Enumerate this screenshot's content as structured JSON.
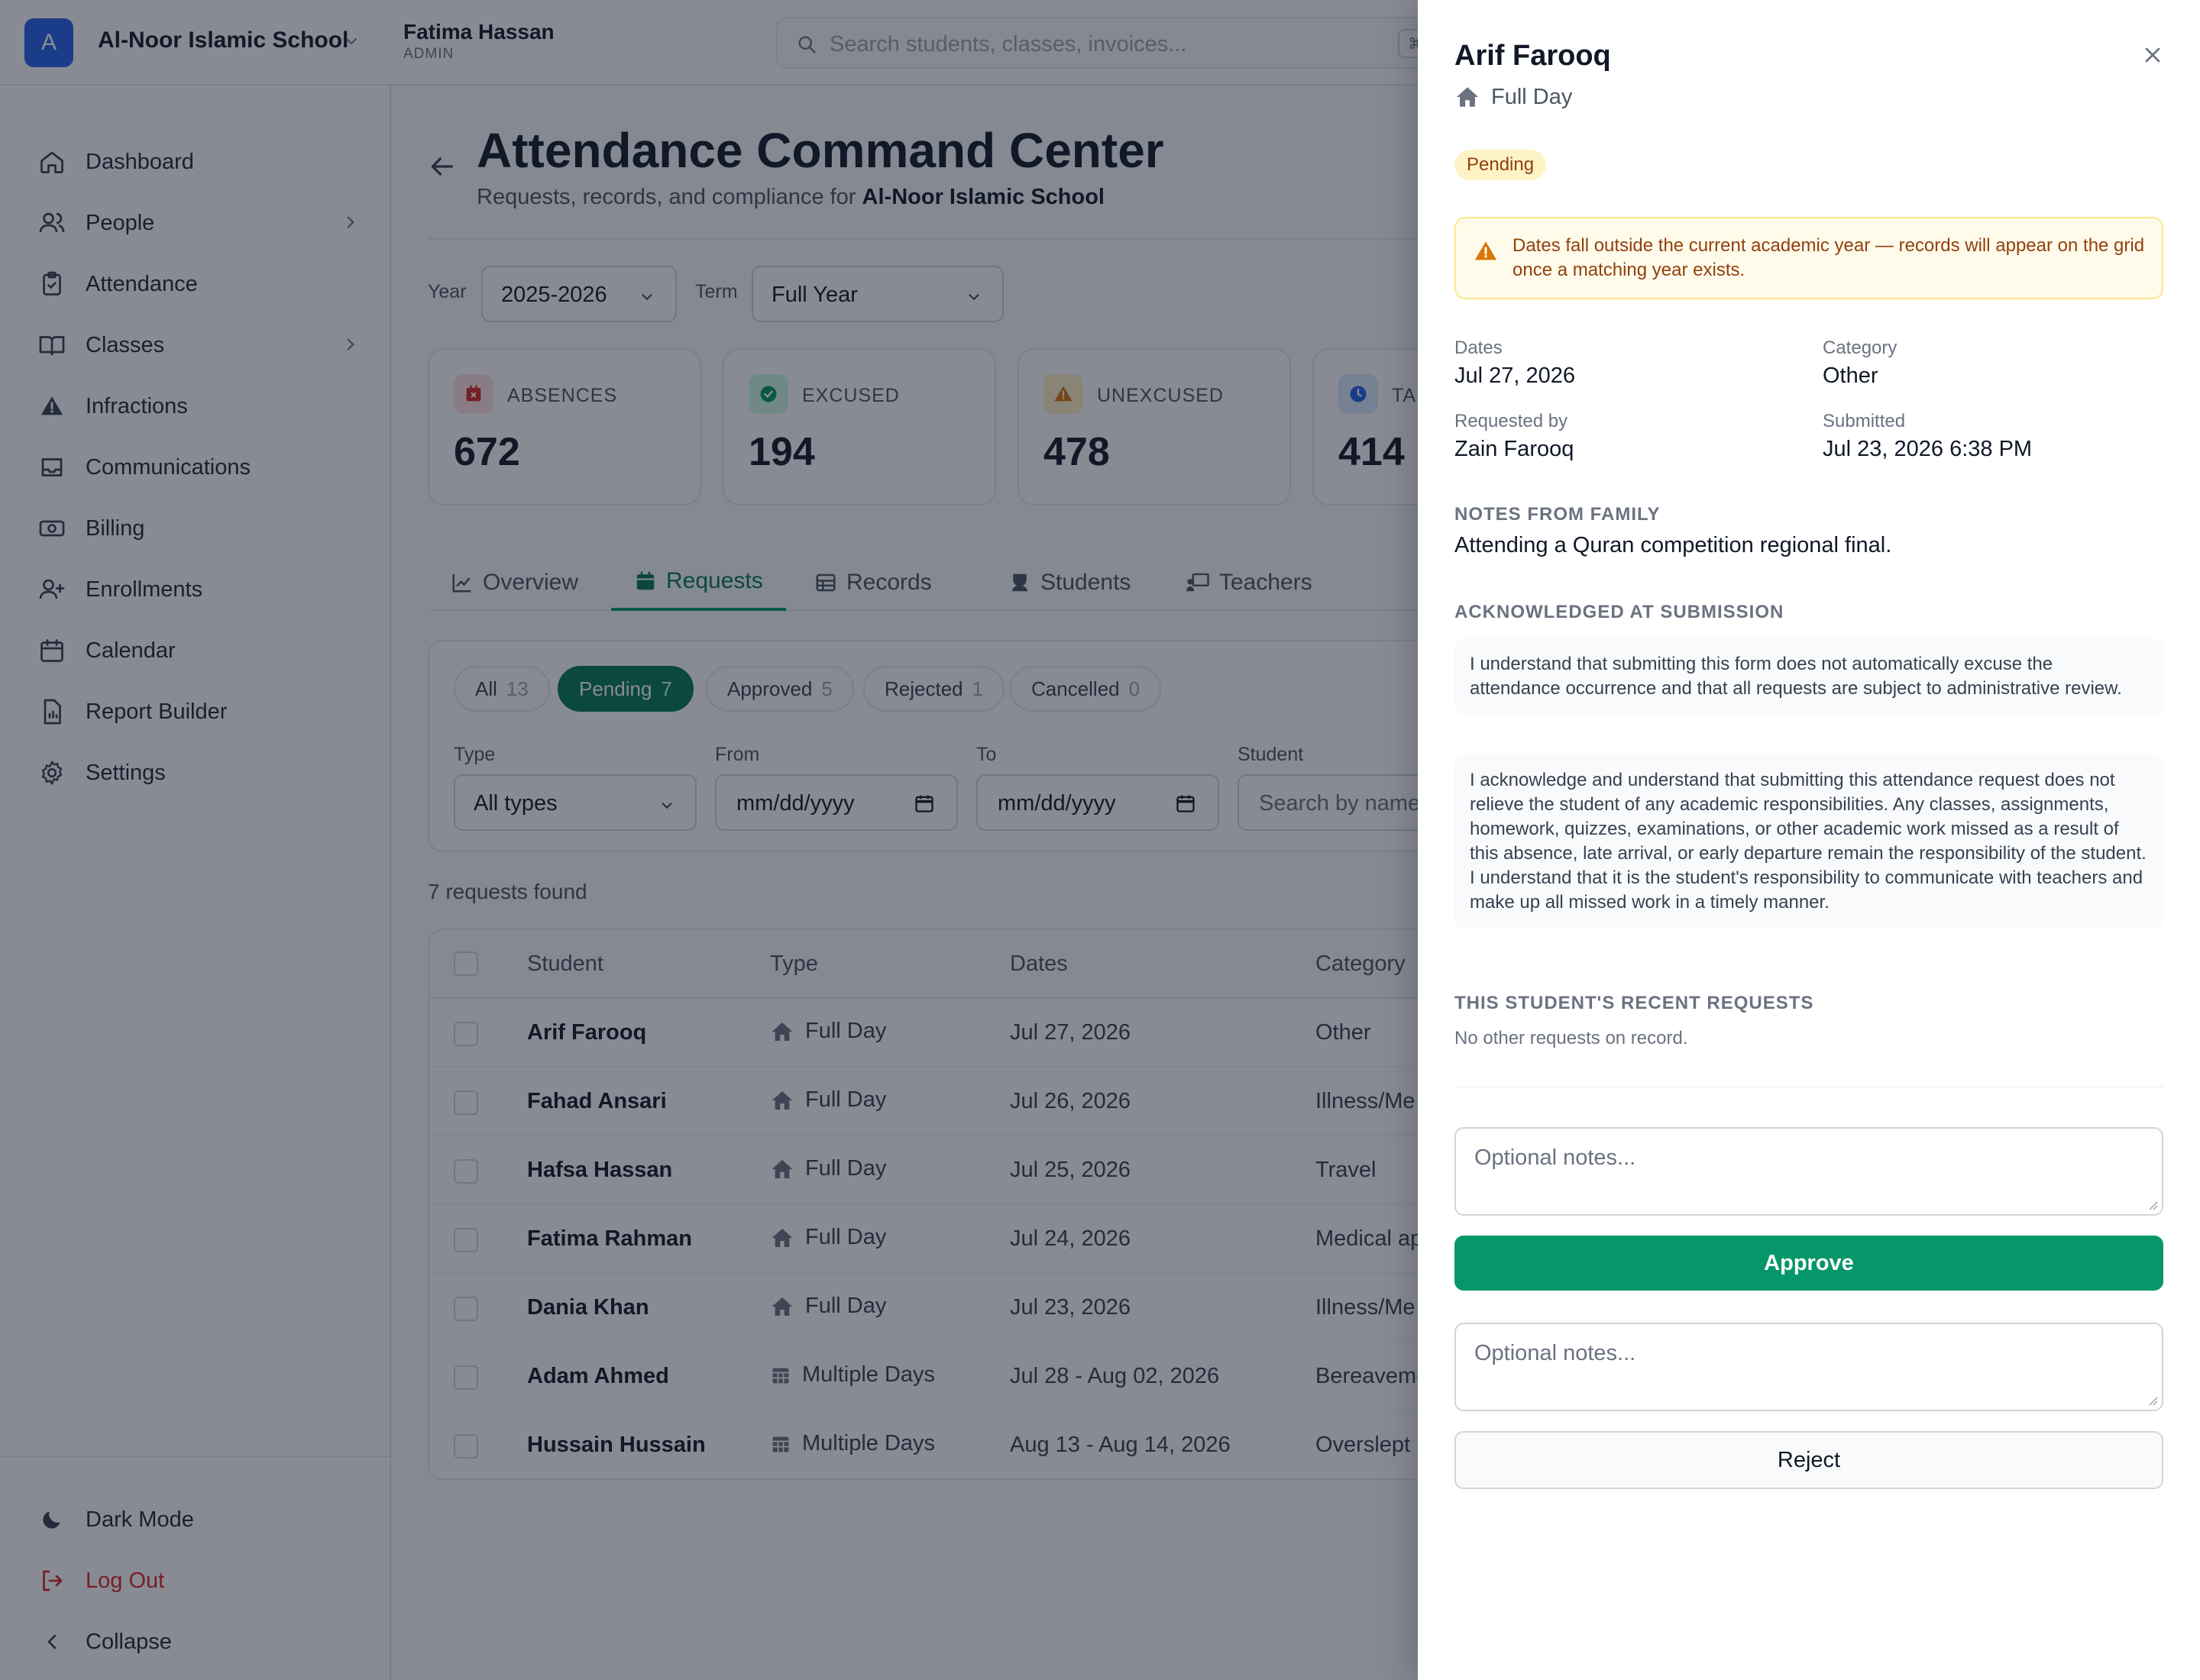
{
  "topbar": {
    "logo_letter": "A",
    "school_name": "Al-Noor Islamic School",
    "user_name": "Fatima Hassan",
    "user_role": "ADMIN",
    "search_placeholder": "Search students, classes, invoices...",
    "shortcut": "⌘K"
  },
  "sidebar": {
    "items": [
      {
        "label": "Dashboard",
        "icon": "home-icon"
      },
      {
        "label": "People",
        "icon": "users-icon"
      },
      {
        "label": "Attendance",
        "icon": "clipboard-check-icon"
      },
      {
        "label": "Classes",
        "icon": "book-open-icon"
      },
      {
        "label": "Infractions",
        "icon": "alert-triangle-icon"
      },
      {
        "label": "Communications",
        "icon": "inbox-icon"
      },
      {
        "label": "Billing",
        "icon": "banknote-icon"
      },
      {
        "label": "Enrollments",
        "icon": "user-plus-icon"
      },
      {
        "label": "Calendar",
        "icon": "calendar-icon"
      },
      {
        "label": "Report Builder",
        "icon": "file-chart-icon"
      },
      {
        "label": "Settings",
        "icon": "gear-icon"
      }
    ],
    "dark_mode": "Dark Mode",
    "log_out": "Log Out",
    "collapse": "Collapse"
  },
  "page": {
    "title": "Attendance Command Center",
    "subtitle_prefix": "Requests, records, and compliance for",
    "subtitle_school": "Al-Noor Islamic School"
  },
  "filters": {
    "year_label": "Year",
    "year_value": "2025-2026",
    "term_label": "Term",
    "term_value": "Full Year"
  },
  "stats": [
    {
      "label": "ABSENCES",
      "value": "672",
      "color": "#dc2626"
    },
    {
      "label": "EXCUSED",
      "value": "194",
      "color": "#059669"
    },
    {
      "label": "UNEXCUSED",
      "value": "478",
      "color": "#d97706"
    },
    {
      "label": "TAR",
      "value": "414",
      "color": "#2563eb"
    }
  ],
  "tabs": [
    {
      "label": "Overview"
    },
    {
      "label": "Requests"
    },
    {
      "label": "Records"
    },
    {
      "label": "Students"
    },
    {
      "label": "Teachers"
    }
  ],
  "request_filters": {
    "chips": [
      {
        "label": "All",
        "count": "13"
      },
      {
        "label": "Pending",
        "count": "7"
      },
      {
        "label": "Approved",
        "count": "5"
      },
      {
        "label": "Rejected",
        "count": "1"
      },
      {
        "label": "Cancelled",
        "count": "0"
      }
    ],
    "type_label": "Type",
    "type_value": "All types",
    "from_label": "From",
    "from_placeholder": "mm/dd/yyyy",
    "to_label": "To",
    "to_placeholder": "mm/dd/yyyy",
    "student_label": "Student",
    "student_placeholder": "Search by name"
  },
  "table": {
    "found_text": "7 requests found",
    "headers": [
      "Student",
      "Type",
      "Dates",
      "Category"
    ],
    "rows": [
      {
        "student": "Arif Farooq",
        "type": "Full Day",
        "type_icon": "home-icon",
        "dates": "Jul 27, 2026",
        "category": "Other"
      },
      {
        "student": "Fahad Ansari",
        "type": "Full Day",
        "type_icon": "home-icon",
        "dates": "Jul 26, 2026",
        "category": "Illness/Me"
      },
      {
        "student": "Hafsa Hassan",
        "type": "Full Day",
        "type_icon": "home-icon",
        "dates": "Jul 25, 2026",
        "category": "Travel"
      },
      {
        "student": "Fatima Rahman",
        "type": "Full Day",
        "type_icon": "home-icon",
        "dates": "Jul 24, 2026",
        "category": "Medical ap"
      },
      {
        "student": "Dania Khan",
        "type": "Full Day",
        "type_icon": "home-icon",
        "dates": "Jul 23, 2026",
        "category": "Illness/Me"
      },
      {
        "student": "Adam Ahmed",
        "type": "Multiple Days",
        "type_icon": "calendar-grid-icon",
        "dates": "Jul 28 - Aug 02, 2026",
        "category": "Bereaveme"
      },
      {
        "student": "Hussain Hussain",
        "type": "Multiple Days",
        "type_icon": "calendar-grid-icon",
        "dates": "Aug 13 - Aug 14, 2026",
        "category": "Overslept"
      }
    ]
  },
  "drawer": {
    "student": "Arif Farooq",
    "type": "Full Day",
    "status": "Pending",
    "warning": "Dates fall outside the current academic year — records will appear on the grid once a matching year exists.",
    "dates_label": "Dates",
    "dates_value": "Jul 27, 2026",
    "category_label": "Category",
    "category_value": "Other",
    "requested_by_label": "Requested by",
    "requested_by_value": "Zain Farooq",
    "submitted_label": "Submitted",
    "submitted_value": "Jul 23, 2026 6:38 PM",
    "notes_heading": "NOTES FROM FAMILY",
    "notes_text": "Attending a Quran competition regional final.",
    "ack_heading": "ACKNOWLEDGED AT SUBMISSION",
    "ack_1": "I understand that submitting this form does not automatically excuse the attendance occurrence and that all requests are subject to administrative review.",
    "ack_2": "I acknowledge and understand that submitting this attendance request does not relieve the student of any academic responsibilities. Any classes, assignments, homework, quizzes, examinations, or other academic work missed as a result of this absence, late arrival, or early departure remain the responsibility of the student. I understand that it is the student's responsibility to communicate with teachers and make up all missed work in a timely manner.",
    "recent_heading": "THIS STUDENT'S RECENT REQUESTS",
    "recent_empty": "No other requests on record.",
    "approve_notes_placeholder": "Optional notes...",
    "approve_label": "Approve",
    "reject_notes_placeholder": "Optional notes...",
    "reject_label": "Reject"
  }
}
